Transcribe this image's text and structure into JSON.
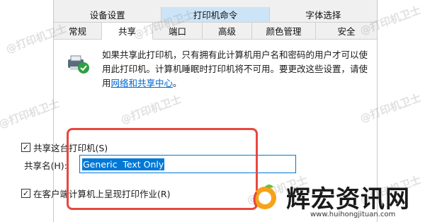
{
  "tabs_row1": [
    "设备设置",
    "打印机命令",
    "字体选择"
  ],
  "tabs_row2": [
    "常规",
    "共享",
    "端口",
    "高级",
    "颜色管理",
    "安全"
  ],
  "description": {
    "line1": "如果共享此打印机，只有拥有此计算机用户名和密码的用户才可以使",
    "line2": "用此打印机。计算机睡眠时打印机将不可用。要更改这些设置，请使",
    "line3_prefix": "用",
    "link": "网络和共享中心",
    "line3_suffix": "。"
  },
  "share_checkbox": {
    "label": "共享这台打印机(S)",
    "checked": true
  },
  "share_name": {
    "label": "共享名(H):",
    "value": "Generic  Text Only"
  },
  "render_checkbox": {
    "label": "在客户端计算机上呈现打印作业(R)",
    "checked": true
  },
  "watermark_text": "@打印机卫士",
  "brand": {
    "title": "辉宏资讯网",
    "url": "www.huihongjituan.com"
  },
  "colors": {
    "highlight": "#e8473f",
    "link": "#0066cc",
    "selection": "#0078d7"
  }
}
